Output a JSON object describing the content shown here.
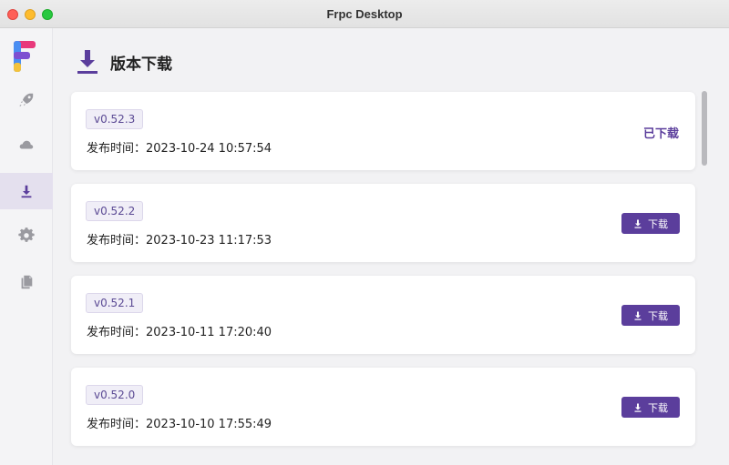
{
  "window": {
    "title": "Frpc Desktop"
  },
  "sidebar": {
    "items": [
      {
        "icon": "rocket-icon",
        "active": false
      },
      {
        "icon": "cloud-icon",
        "active": false
      },
      {
        "icon": "download-icon",
        "active": true
      },
      {
        "icon": "gear-icon",
        "active": false
      },
      {
        "icon": "documents-icon",
        "active": false
      }
    ]
  },
  "header": {
    "title": "版本下载",
    "icon": "download-icon"
  },
  "releases": [
    {
      "version": "v0.52.3",
      "release_text": "发布时间：2023-10-24 10:57:54",
      "status": "已下载"
    },
    {
      "version": "v0.52.2",
      "release_text": "发布时间：2023-10-23 11:17:53",
      "action": "下载"
    },
    {
      "version": "v0.52.1",
      "release_text": "发布时间：2023-10-11 17:20:40",
      "action": "下载"
    },
    {
      "version": "v0.52.0",
      "release_text": "发布时间：2023-10-10 17:55:49",
      "action": "下载"
    }
  ],
  "colors": {
    "accent": "#5b3e9c",
    "badge_bg": "#f0eef7"
  }
}
